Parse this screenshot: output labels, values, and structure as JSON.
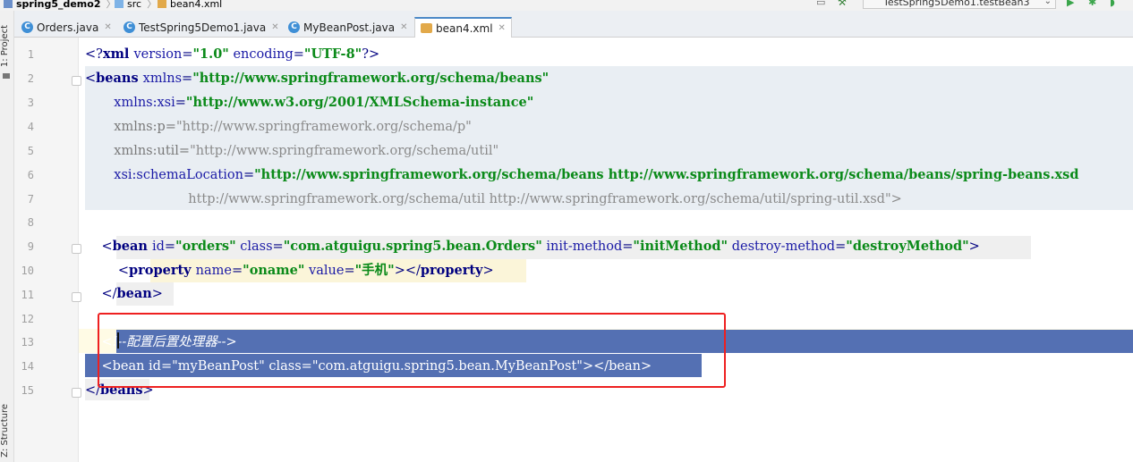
{
  "breadcrumb": {
    "project": "spring5_demo2",
    "folder": "src",
    "file": "bean4.xml"
  },
  "toolbar": {
    "run_config": "TestSpring5Demo1.testBean3"
  },
  "tool_windows": {
    "project": "1: Project",
    "structure": "Z: Structure"
  },
  "tabs": [
    {
      "label": "Orders.java",
      "active": false
    },
    {
      "label": "TestSpring5Demo1.java",
      "active": false
    },
    {
      "label": "MyBeanPost.java",
      "active": false
    },
    {
      "label": "bean4.xml",
      "active": true
    }
  ],
  "line_numbers": [
    "1",
    "2",
    "3",
    "4",
    "5",
    "6",
    "7",
    "8",
    "9",
    "10",
    "11",
    "12",
    "13",
    "14",
    "15"
  ],
  "code": {
    "l1": {
      "p1": "<?",
      "t1": "xml ",
      "a1": "version",
      "p2": "=",
      "v1": "\"1.0\"",
      "sp": " ",
      "a2": "encoding",
      "p3": "=",
      "v2": "\"UTF-8\"",
      "p4": "?>"
    },
    "l2": {
      "p1": "<",
      "t1": "beans ",
      "a1": "xmlns",
      "p2": "=",
      "v1": "\"http://www.springframework.org/schema/beans\""
    },
    "l3": {
      "ind": "       ",
      "a1": "xmlns:xsi",
      "p1": "=",
      "v1": "\"http://www.w3.org/2001/XMLSchema-instance\""
    },
    "l4": {
      "ind": "       ",
      "g1": "xmlns:p=",
      "gv1": "\"http://www.springframework.org/schema/p\""
    },
    "l5": {
      "ind": "       ",
      "g1": "xmlns:util=",
      "gv1": "\"http://www.springframework.org/schema/util\""
    },
    "l6": {
      "ind": "       ",
      "a1": "xsi:schemaLocation",
      "p1": "=",
      "v1": "\"http://www.springframework.org/schema/beans http://www.springframework.org/schema/beans/spring-beans.xsd"
    },
    "l7": {
      "ind": "                         ",
      "gv1": "http://www.springframework.org/schema/util http://www.springframework.org/schema/util/spring-util.xsd\">"
    },
    "l9": {
      "ind": "    ",
      "p1": "<",
      "t1": "bean ",
      "a1": "id",
      "p2": "=",
      "v1": "\"orders\"",
      "s1": " ",
      "a2": "class",
      "p3": "=",
      "v2": "\"com.atguigu.spring5.bean.Orders\"",
      "s2": " ",
      "a3": "init-method",
      "p4": "=",
      "v3": "\"initMethod\"",
      "s3": " ",
      "a4": "destroy-method",
      "p5": "=",
      "v4": "\"destroyMethod\"",
      "p6": ">"
    },
    "l10": {
      "ind": "        ",
      "p1": "<",
      "t1": "property ",
      "a1": "name",
      "p2": "=",
      "v1": "\"oname\"",
      "s1": " ",
      "a2": "value",
      "p3": "=",
      "v2": "\"手机\"",
      "p4": "></",
      "t2": "property",
      "p5": ">"
    },
    "l11": {
      "ind": "    ",
      "p1": "</",
      "t1": "bean",
      "p2": ">"
    },
    "l13": {
      "ind": "    ",
      "c1": "<!--配置后置处理器-->"
    },
    "l14": {
      "ind": "    ",
      "s1": "<bean id=\"myBeanPost\" class=\"com.atguigu.spring5.bean.MyBeanPost\"></bean>"
    },
    "l15": {
      "p1": "</",
      "t1": "beans",
      "p2": ">"
    }
  },
  "colors": {
    "selection": "#5470b3",
    "highlight_box": "#ee2020",
    "tag": "#000080",
    "attr_value": "#0b8a19"
  }
}
